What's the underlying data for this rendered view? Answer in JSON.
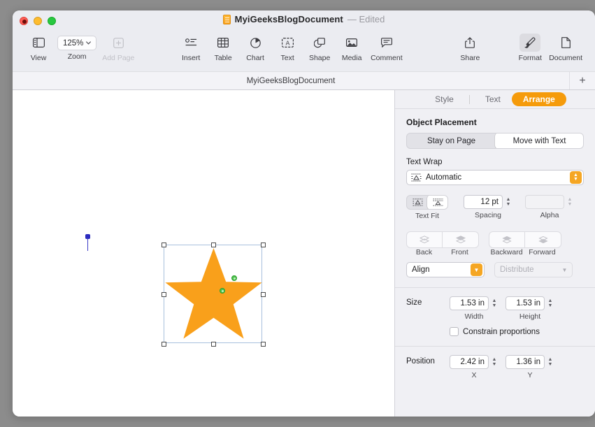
{
  "window": {
    "title_name": "MyiGeeksBlogDocument",
    "title_status": "— Edited",
    "traffic_lights": [
      "close-button",
      "minimize-button",
      "zoom-button"
    ]
  },
  "toolbar": {
    "view": {
      "label": "View",
      "icon": "sidebar-icon",
      "enabled": true
    },
    "zoom": {
      "label": "Zoom",
      "value": "125%",
      "icon": "chevron-down-icon",
      "enabled": true
    },
    "add_page": {
      "label": "Add Page",
      "icon": "add-page-icon",
      "enabled": false
    },
    "insert": {
      "label": "Insert",
      "icon": "insert-icon",
      "enabled": true
    },
    "table": {
      "label": "Table",
      "icon": "table-icon",
      "enabled": true
    },
    "chart": {
      "label": "Chart",
      "icon": "chart-pie-icon",
      "enabled": true
    },
    "text": {
      "label": "Text",
      "icon": "text-box-icon",
      "enabled": true
    },
    "shape": {
      "label": "Shape",
      "icon": "shape-icon",
      "enabled": true
    },
    "media": {
      "label": "Media",
      "icon": "media-image-icon",
      "enabled": true
    },
    "comment": {
      "label": "Comment",
      "icon": "comment-icon",
      "enabled": true
    },
    "share": {
      "label": "Share",
      "icon": "share-icon",
      "enabled": true
    },
    "format": {
      "label": "Format",
      "icon": "format-brush-icon",
      "enabled": true,
      "active": true
    },
    "document": {
      "label": "Document",
      "icon": "document-icon",
      "enabled": true
    }
  },
  "tabbar": {
    "document_tab": "MyiGeeksBlogDocument",
    "add_tab": "+"
  },
  "canvas": {
    "anchor_marker": "text-anchor-pin",
    "shape": {
      "type": "five-pointed-star",
      "fill_color": "#f9a01b",
      "selected": true,
      "handles": 8,
      "control_points": 2
    }
  },
  "inspector": {
    "tabs": [
      {
        "label": "Style",
        "selected": false
      },
      {
        "label": "Text",
        "selected": false
      },
      {
        "label": "Arrange",
        "selected": true
      }
    ],
    "object_placement": {
      "title": "Object Placement",
      "options": [
        {
          "label": "Stay on Page",
          "selected": false
        },
        {
          "label": "Move with Text",
          "selected": true
        }
      ]
    },
    "text_wrap": {
      "label": "Text Wrap",
      "value": "Automatic",
      "icon": "text-wrap-icon"
    },
    "text_fit": {
      "label": "Text Fit",
      "options": [
        {
          "icon": "text-fit-around-icon",
          "selected": false
        },
        {
          "icon": "text-fit-above-below-icon",
          "selected": true
        }
      ]
    },
    "spacing": {
      "label": "Spacing",
      "value": "12 pt",
      "enabled": true
    },
    "alpha": {
      "label": "Alpha",
      "value": "",
      "enabled": false
    },
    "layers": {
      "group_one": [
        {
          "label": "Back",
          "icon": "send-to-back-icon",
          "enabled": false
        },
        {
          "label": "Front",
          "icon": "bring-to-front-icon",
          "enabled": false
        }
      ],
      "group_two": [
        {
          "label": "Backward",
          "icon": "send-backward-icon",
          "enabled": false
        },
        {
          "label": "Forward",
          "icon": "bring-forward-icon",
          "enabled": false
        }
      ]
    },
    "align": {
      "label": "Align",
      "enabled": true
    },
    "distribute": {
      "label": "Distribute",
      "enabled": false
    },
    "size": {
      "label": "Size",
      "width": {
        "value": "1.53 in",
        "sub_label": "Width"
      },
      "height": {
        "value": "1.53 in",
        "sub_label": "Height"
      },
      "constrain": {
        "label": "Constrain proportions",
        "checked": false
      }
    },
    "position": {
      "label": "Position",
      "x": {
        "value": "2.42 in",
        "sub_label": "X"
      },
      "y": {
        "value": "1.36 in",
        "sub_label": "Y"
      }
    }
  },
  "colors": {
    "accent_orange": "#f5a623",
    "star_fill": "#f9a01b",
    "selection_blue": "#a8c0dd",
    "anchor_blue": "#2b2bbf",
    "control_green": "#4cc24c",
    "desktop_gray": "#8c8c8c",
    "chrome_gray": "#ebecf1",
    "inspector_gray": "#f0f0f4"
  }
}
